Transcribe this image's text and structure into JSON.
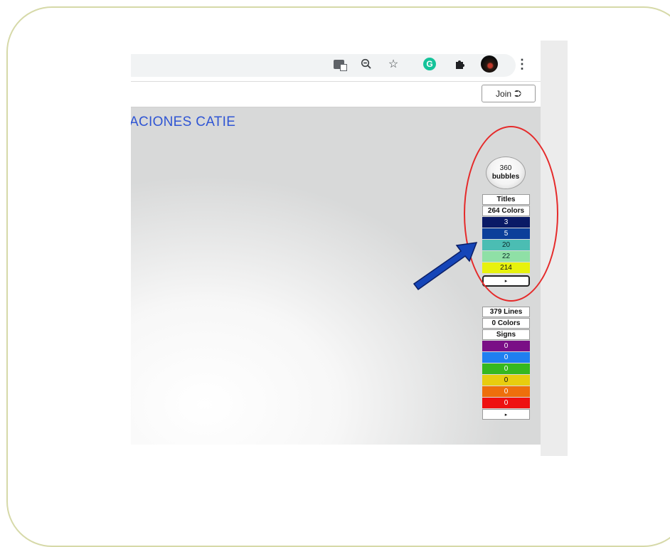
{
  "browser": {
    "icons": [
      "translate-icon",
      "zoom-out-icon",
      "star-icon",
      "grammarly-icon",
      "extensions-icon",
      "profile-avatar",
      "menu-kebab-icon"
    ]
  },
  "header": {
    "join_label": "Join",
    "page_title": "ACIONES CATIE"
  },
  "bubbles": {
    "count": "360",
    "label": "bubbles"
  },
  "titles_panel": {
    "title": "Titles",
    "colors_label": "264 Colors",
    "swatches": [
      {
        "value": "3",
        "color": "#0a1a66",
        "text_color": "#ffffff"
      },
      {
        "value": "5",
        "color": "#0b3f9a",
        "text_color": "#ffffff"
      },
      {
        "value": "20",
        "color": "#4bbdb3",
        "text_color": "#0a2a2a"
      },
      {
        "value": "22",
        "color": "#8fe0a6",
        "text_color": "#0a2a2a"
      },
      {
        "value": "214",
        "color": "#e7f20d",
        "text_color": "#111111"
      }
    ],
    "expand": "▸"
  },
  "lines_panel": {
    "lines_label": "379 Lines",
    "colors_label": "0 Colors",
    "signs_label": "Signs",
    "swatches": [
      {
        "value": "0",
        "color": "#7a0f86",
        "text_color": "#ffffff"
      },
      {
        "value": "0",
        "color": "#1f7ff0",
        "text_color": "#ffffff"
      },
      {
        "value": "0",
        "color": "#36b81f",
        "text_color": "#ffffff"
      },
      {
        "value": "0",
        "color": "#e8cd0f",
        "text_color": "#111111"
      },
      {
        "value": "0",
        "color": "#ee6f0c",
        "text_color": "#ffffff"
      },
      {
        "value": "0",
        "color": "#ee1111",
        "text_color": "#ffffff"
      }
    ],
    "expand": "▸"
  },
  "annotation": {
    "ellipse_color": "#e52a2a",
    "arrow_color": "#1545b8"
  }
}
